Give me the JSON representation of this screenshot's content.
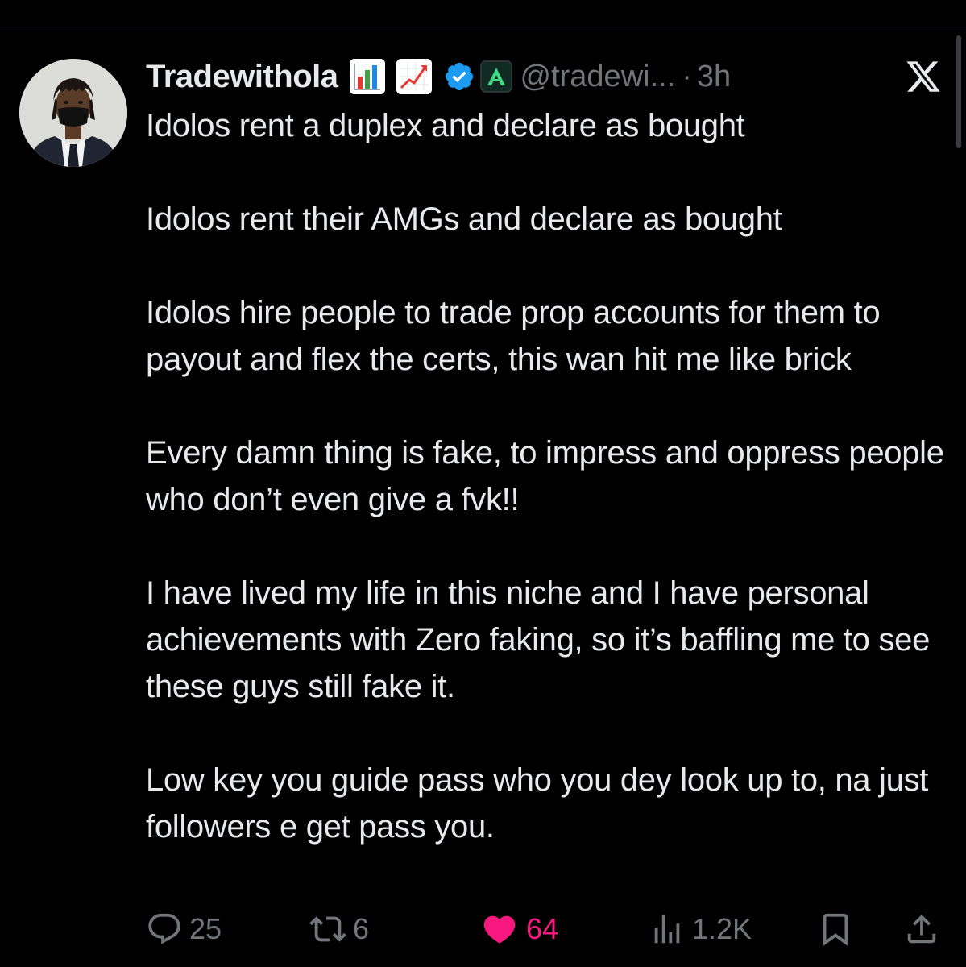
{
  "tweet": {
    "display_name": "Tradewithola",
    "emojis": [
      "bar-chart-icon",
      "chart-increasing-icon"
    ],
    "handle": "@tradewi...",
    "separator": "·",
    "time": "3h",
    "affiliate_badge": "A",
    "paragraphs": [
      "Idolos rent a duplex and declare as bought",
      "Idolos rent their AMGs and declare as bought",
      "Idolos hire people to trade prop accounts for them to payout and flex the certs, this wan hit me like brick",
      "Every damn thing is fake, to impress and oppress people who don’t even give a fvk!!",
      "I have lived my life in this niche and I have personal achievements with Zero faking, so it’s baffling me to see these guys still fake it.",
      "Low key you guide pass who you dey look up to, na just followers e get pass you."
    ]
  },
  "actions": {
    "replies": "25",
    "reposts": "6",
    "likes": "64",
    "views": "1.2K"
  },
  "colors": {
    "background": "#000000",
    "text": "#e7e9ea",
    "muted": "#71767b",
    "like": "#f91880",
    "verified": "#1d9bf0"
  }
}
